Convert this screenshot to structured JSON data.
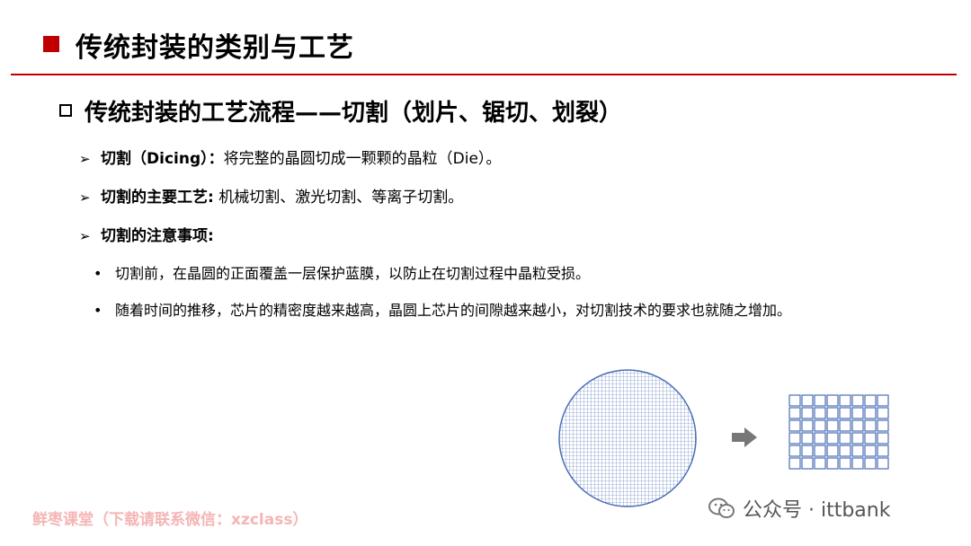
{
  "header": {
    "title": "传统封装的类别与工艺"
  },
  "section": {
    "heading": "传统封装的工艺流程——切割（划片、锯切、划裂）"
  },
  "points": [
    {
      "bold": "切割（Dicing）：",
      "text": "将完整的晶圆切成一颗颗的晶粒（Die）。"
    },
    {
      "bold": "切割的主要工艺:",
      "text": " 机械切割、激光切割、等离子切割。"
    },
    {
      "bold": "切割的注意事项:",
      "text": ""
    }
  ],
  "notes": [
    "切割前，在晶圆的正面覆盖一层保护蓝膜，以防止在切割过程中晶粒受损。",
    "随着时间的推移，芯片的精密度越来越高，晶圆上芯片的间隙越来越小，对切割技术的要求也就随之增加。"
  ],
  "watermark": {
    "left": "鲜枣课堂（下载请联系微信：xzclass）",
    "right": "公众号 · ittbank"
  },
  "colors": {
    "accent": "#c00000",
    "wafer": "#4a6fb5",
    "arrow": "#777777"
  },
  "icons": {
    "title_marker": "red-square",
    "sub_marker": "hollow-square",
    "point_marker": "arrowhead",
    "note_marker": "bullet-dot",
    "brand": "wechat-icon"
  }
}
